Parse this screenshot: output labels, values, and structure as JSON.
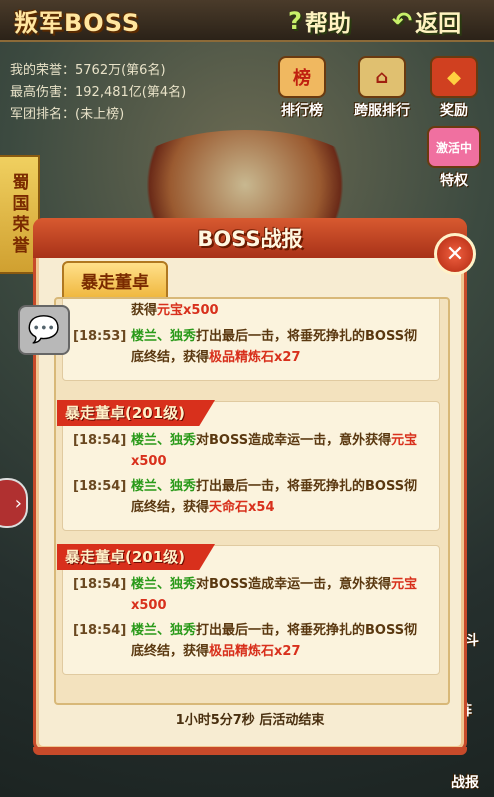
{
  "header": {
    "title": "叛军BOSS",
    "help_label": "帮助",
    "back_label": "返回"
  },
  "stats": {
    "honor_label": "我的荣誉：",
    "honor_value": "5762万(第6名)",
    "damage_label": "最高伤害：",
    "damage_value": "192,481亿(第4名)",
    "legion_label": "军团排名：",
    "legion_value": "(未上榜)"
  },
  "toolbar": {
    "ranking": "排行榜",
    "ranking_badge": "榜",
    "cross_server": "跨服排行",
    "reward": "奖励",
    "activate_badge": "激活中",
    "privilege": "特权"
  },
  "side_banner": "蜀国荣誉",
  "right_items": {
    "fight": "战斗",
    "formation": "阵",
    "report": "战报"
  },
  "modal": {
    "title": "BOSS战报",
    "tab_label": "暴走董卓",
    "footer": "1小时5分7秒 后活动结束",
    "cards": [
      {
        "ribbon": "",
        "entries": [
          {
            "time": "",
            "pre": "获得",
            "name": "",
            "mid": "",
            "item": "元宝x500"
          },
          {
            "time": "[18:53]",
            "name": "楼兰、独秀",
            "mid": "打出最后一击，将垂死挣扎的BOSS彻底终结，获得",
            "item": "极品精炼石x27"
          }
        ]
      },
      {
        "ribbon": "暴走董卓(201级)",
        "entries": [
          {
            "time": "[18:54]",
            "name": "楼兰、独秀",
            "mid": "对BOSS造成幸运一击，意外获得",
            "item": "元宝x500"
          },
          {
            "time": "[18:54]",
            "name": "楼兰、独秀",
            "mid": "打出最后一击，将垂死挣扎的BOSS彻底终结，获得",
            "item": "天命石x54"
          }
        ]
      },
      {
        "ribbon": "暴走董卓(201级)",
        "entries": [
          {
            "time": "[18:54]",
            "name": "楼兰、独秀",
            "mid": "对BOSS造成幸运一击，意外获得",
            "item": "元宝x500"
          },
          {
            "time": "[18:54]",
            "name": "楼兰、独秀",
            "mid": "打出最后一击，将垂死挣扎的BOSS彻底终结，获得",
            "item": "极品精炼石x27"
          }
        ]
      }
    ]
  },
  "colors": {
    "accent": "#d8301c",
    "highlight_green": "#2a9a1a",
    "panel": "#f7ecd2"
  },
  "icons": {
    "help": "question-icon",
    "back": "back-arrow-icon",
    "close": "close-icon",
    "chat": "chat-bubble-icon"
  }
}
